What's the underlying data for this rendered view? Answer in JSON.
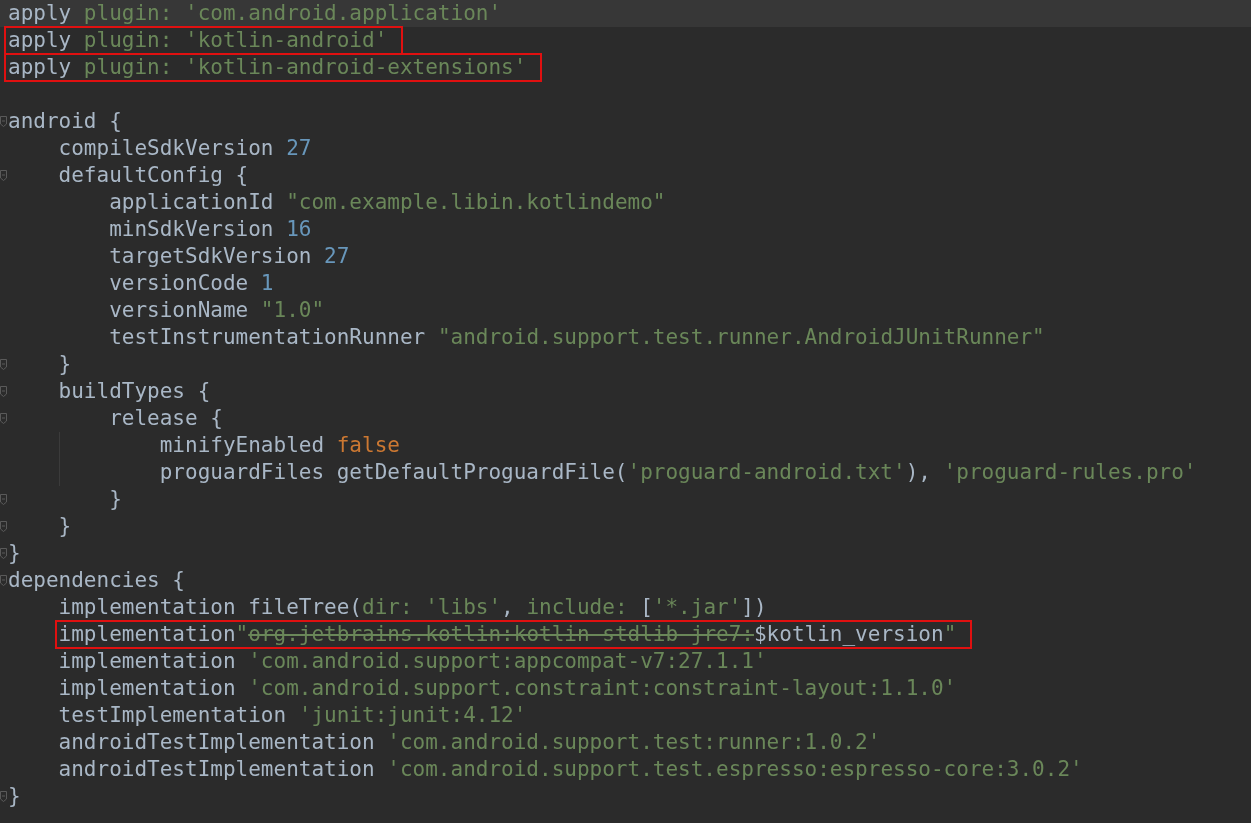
{
  "editor": {
    "lines": [
      {
        "current": true,
        "fold_marker": false,
        "boxed": false,
        "tokens": [
          {
            "kind": "plain",
            "text": "apply "
          },
          {
            "kind": "string",
            "text": "plugin: 'com.android.application'"
          }
        ]
      },
      {
        "current": false,
        "fold_marker": false,
        "boxed": true,
        "tokens": [
          {
            "kind": "plain",
            "text": "apply "
          },
          {
            "kind": "string",
            "text": "plugin: 'kotlin-android'"
          }
        ]
      },
      {
        "current": false,
        "fold_marker": false,
        "boxed": true,
        "tokens": [
          {
            "kind": "plain",
            "text": "apply "
          },
          {
            "kind": "string",
            "text": "plugin: 'kotlin-android-extensions'"
          }
        ]
      },
      {
        "current": false,
        "fold_marker": false,
        "boxed": false
      },
      {
        "current": false,
        "fold_marker": true,
        "boxed": false,
        "tokens": [
          {
            "kind": "plain",
            "text": "android {"
          }
        ],
        "children": [
          {
            "current": false,
            "fold_marker": false,
            "boxed": false,
            "tokens": [
              {
                "kind": "plain",
                "text": "compileSdkVersion "
              },
              {
                "kind": "number",
                "text": "27"
              }
            ]
          },
          {
            "current": false,
            "fold_marker": true,
            "boxed": false,
            "tokens": [
              {
                "kind": "plain",
                "text": "defaultConfig {"
              }
            ],
            "children": [
              {
                "current": false,
                "fold_marker": false,
                "boxed": false,
                "tokens": [
                  {
                    "kind": "plain",
                    "text": "applicationId "
                  },
                  {
                    "kind": "string",
                    "text": "\"com.example.libin.kotlindemo\""
                  }
                ]
              },
              {
                "current": false,
                "fold_marker": false,
                "boxed": false,
                "tokens": [
                  {
                    "kind": "plain",
                    "text": "minSdkVersion "
                  },
                  {
                    "kind": "number",
                    "text": "16"
                  }
                ]
              },
              {
                "current": false,
                "fold_marker": false,
                "boxed": false,
                "tokens": [
                  {
                    "kind": "plain",
                    "text": "targetSdkVersion "
                  },
                  {
                    "kind": "number",
                    "text": "27"
                  }
                ]
              },
              {
                "current": false,
                "fold_marker": false,
                "boxed": false,
                "tokens": [
                  {
                    "kind": "plain",
                    "text": "versionCode "
                  },
                  {
                    "kind": "number",
                    "text": "1"
                  }
                ]
              },
              {
                "current": false,
                "fold_marker": false,
                "boxed": false,
                "tokens": [
                  {
                    "kind": "plain",
                    "text": "versionName "
                  },
                  {
                    "kind": "string",
                    "text": "\"1.0\""
                  }
                ]
              },
              {
                "current": false,
                "fold_marker": false,
                "boxed": false,
                "tokens": [
                  {
                    "kind": "plain",
                    "text": "testInstrumentationRunner "
                  },
                  {
                    "kind": "string",
                    "text": "\"android.support.test.runner.AndroidJUnitRunner\""
                  }
                ]
              }
            ]
          },
          {
            "current": false,
            "fold_marker": true,
            "boxed": false,
            "tokens": [
              {
                "kind": "plain",
                "text": "}"
              }
            ]
          },
          {
            "current": false,
            "fold_marker": true,
            "boxed": false,
            "tokens": [
              {
                "kind": "plain",
                "text": "buildTypes {"
              }
            ],
            "children": [
              {
                "current": false,
                "fold_marker": true,
                "boxed": false,
                "tokens": [
                  {
                    "kind": "plain",
                    "text": "release {"
                  }
                ],
                "children": [
                  {
                    "current": false,
                    "fold_marker": false,
                    "boxed": false,
                    "tokens": [
                      {
                        "kind": "plain",
                        "text": "minifyEnabled "
                      },
                      {
                        "kind": "keyword",
                        "text": "false"
                      }
                    ]
                  },
                  {
                    "current": false,
                    "fold_marker": false,
                    "boxed": false,
                    "tokens": [
                      {
                        "kind": "plain",
                        "text": "proguardFiles getDefaultProguardFile("
                      },
                      {
                        "kind": "string",
                        "text": "'proguard-android.txt'"
                      },
                      {
                        "kind": "plain",
                        "text": "), "
                      },
                      {
                        "kind": "string",
                        "text": "'proguard-rules.pro'"
                      }
                    ]
                  }
                ]
              },
              {
                "current": false,
                "fold_marker": true,
                "boxed": false,
                "tokens": [
                  {
                    "kind": "plain",
                    "text": "}"
                  }
                ]
              }
            ]
          },
          {
            "current": false,
            "fold_marker": true,
            "boxed": false,
            "tokens": [
              {
                "kind": "plain",
                "text": "}"
              }
            ]
          }
        ]
      },
      {
        "current": false,
        "fold_marker": true,
        "boxed": false,
        "tokens": [
          {
            "kind": "plain",
            "text": "}"
          }
        ]
      },
      {
        "current": false,
        "fold_marker": true,
        "boxed": false,
        "tokens": [
          {
            "kind": "plain",
            "text": "dependencies {"
          }
        ],
        "children": [
          {
            "current": false,
            "fold_marker": false,
            "boxed": false,
            "tokens": [
              {
                "kind": "plain",
                "text": "implementation fileTree("
              },
              {
                "kind": "string",
                "text": "dir: "
              },
              {
                "kind": "string",
                "text": "'libs'"
              },
              {
                "kind": "plain",
                "text": ", "
              },
              {
                "kind": "string",
                "text": "include: "
              },
              {
                "kind": "plain",
                "text": "["
              },
              {
                "kind": "string",
                "text": "'*.jar'"
              },
              {
                "kind": "plain",
                "text": "])"
              }
            ]
          },
          {
            "current": false,
            "fold_marker": false,
            "boxed": true,
            "tokens": [
              {
                "kind": "plain",
                "text": "implementation"
              },
              {
                "kind": "string",
                "text": "\""
              },
              {
                "kind": "deprecated",
                "text": "org.jetbrains.kotlin:kotlin-stdlib-jre7:"
              },
              {
                "kind": "plain",
                "text": "$kotlin_version"
              },
              {
                "kind": "string",
                "text": "\""
              }
            ]
          },
          {
            "current": false,
            "fold_marker": false,
            "boxed": false,
            "tokens": [
              {
                "kind": "plain",
                "text": "implementation "
              },
              {
                "kind": "string",
                "text": "'com.android.support:appcompat-v7:27.1.1'"
              }
            ]
          },
          {
            "current": false,
            "fold_marker": false,
            "boxed": false,
            "tokens": [
              {
                "kind": "plain",
                "text": "implementation "
              },
              {
                "kind": "string",
                "text": "'com.android.support.constraint:constraint-layout:1.1.0'"
              }
            ]
          },
          {
            "current": false,
            "fold_marker": false,
            "boxed": false,
            "tokens": [
              {
                "kind": "plain",
                "text": "testImplementation "
              },
              {
                "kind": "string",
                "text": "'junit:junit:4.12'"
              }
            ]
          },
          {
            "current": false,
            "fold_marker": false,
            "boxed": false,
            "tokens": [
              {
                "kind": "plain",
                "text": "androidTestImplementation "
              },
              {
                "kind": "string",
                "text": "'com.android.support.test:runner:1.0.2'"
              }
            ]
          },
          {
            "current": false,
            "fold_marker": false,
            "boxed": false,
            "tokens": [
              {
                "kind": "plain",
                "text": "androidTestImplementation "
              },
              {
                "kind": "string",
                "text": "'com.android.support.test.espresso:espresso-core:3.0.2'"
              }
            ]
          }
        ]
      },
      {
        "current": false,
        "fold_marker": true,
        "boxed": false,
        "tokens": [
          {
            "kind": "plain",
            "text": "}"
          }
        ]
      }
    ]
  }
}
